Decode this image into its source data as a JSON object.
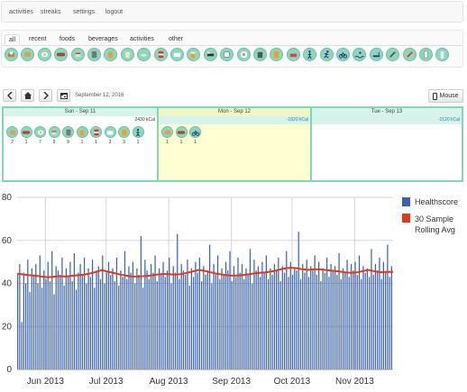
{
  "nav": {
    "items": [
      "activities",
      "streaks",
      "settings",
      "logout"
    ]
  },
  "tabs": {
    "items": [
      "all",
      "recent",
      "foods",
      "beverages",
      "activities",
      "other"
    ],
    "active": "all"
  },
  "icons": [
    "breakfast-icon",
    "toast-icon",
    "egg-icon",
    "hotdog-icon",
    "cake-icon",
    "mixer-icon",
    "jar-icon",
    "drink-icon",
    "bowl-icon",
    "cola-icon",
    "soup-icon",
    "beer-icon",
    "bed-icon",
    "cup-icon",
    "plate-icon",
    "trash-icon",
    "medicine-icon",
    "sofa-icon",
    "walk-icon",
    "run-icon",
    "bike-icon",
    "swim-icon",
    "treadmill-icon",
    "syringe-icon",
    "pencil-icon",
    "blender-icon",
    "bottle-icon"
  ],
  "toolbar": {
    "date": "September 12, 2016",
    "mouse_label": "Mouse"
  },
  "calendar": {
    "days": [
      {
        "header": "Sun - Sep 11",
        "kcal": "2430 kCal",
        "entries": [
          {
            "icon": "toast-icon",
            "count": "2"
          },
          {
            "icon": "hotdog-icon",
            "count": "1"
          },
          {
            "icon": "egg-icon",
            "count": "7"
          },
          {
            "icon": "cake-icon",
            "count": "9"
          },
          {
            "icon": "mixer-icon",
            "count": "9"
          },
          {
            "icon": "jar-icon",
            "count": "1"
          },
          {
            "icon": "cola-icon",
            "count": "1"
          },
          {
            "icon": "soup-icon",
            "count": "3"
          },
          {
            "icon": "medicine-icon",
            "count": "3"
          },
          {
            "icon": "walk-icon",
            "count": "1"
          }
        ]
      },
      {
        "header": "Mon - Sep 12",
        "kcal": "-1920 kCal",
        "entries": [
          {
            "icon": "toast-icon",
            "count": "1"
          },
          {
            "icon": "hotdog-icon",
            "count": "1"
          },
          {
            "icon": "bike-icon",
            "count": "1"
          }
        ]
      },
      {
        "header": "Tue - Sep 13",
        "kcal": "-2120 kCal",
        "entries": []
      }
    ]
  },
  "colors": {
    "accent": "#7fd7b6",
    "icon_bg": "#8ed7bd",
    "today_bg": "#ffffd2",
    "bar": "#3a62b0",
    "avg": "#dd3a1a"
  },
  "chart_data": {
    "type": "bar",
    "title": "",
    "xlabel": "",
    "ylabel": "",
    "ylim": [
      0,
      80
    ],
    "yticks": [
      0,
      20,
      40,
      60,
      80
    ],
    "x_tick_labels": [
      "Jun 2013",
      "Jul 2013",
      "Aug 2013",
      "Sep 2013",
      "Oct 2013",
      "Nov 2013"
    ],
    "x_range": [
      "2013-05-18",
      "2013-11-20"
    ],
    "grid": true,
    "legend": "right",
    "series": [
      {
        "name": "Healthscore",
        "kind": "bar",
        "x_start": "2013-05-18",
        "step_days": 1,
        "values": [
          44,
          49,
          22,
          45,
          40,
          51,
          36,
          47,
          44,
          49,
          40,
          53,
          38,
          46,
          42,
          50,
          41,
          55,
          35,
          48,
          46,
          44,
          52,
          39,
          47,
          43,
          50,
          41,
          54,
          37,
          45,
          49,
          44,
          52,
          40,
          47,
          43,
          51,
          38,
          46,
          48,
          42,
          53,
          40,
          45,
          50,
          44,
          47,
          41,
          52,
          39,
          46,
          43,
          55,
          42,
          48,
          45,
          50,
          40,
          47,
          44,
          62,
          38,
          51,
          46,
          42,
          49,
          45,
          53,
          41,
          47,
          44,
          50,
          43,
          46,
          52,
          40,
          48,
          45,
          63,
          42,
          49,
          46,
          44,
          51,
          39,
          47,
          43,
          50,
          45,
          52,
          41,
          48,
          44,
          46,
          58,
          40,
          49,
          45,
          53,
          42,
          47,
          44,
          50,
          46,
          55,
          41,
          48,
          43,
          52,
          45,
          49,
          42,
          47,
          44,
          56,
          40,
          51,
          46,
          48,
          43,
          50,
          45,
          53,
          42,
          47,
          44,
          49,
          46,
          52,
          41,
          48,
          45,
          55,
          43,
          50,
          44,
          47,
          46,
          64,
          42,
          49,
          45,
          51,
          43,
          48,
          46,
          53,
          44,
          50,
          41,
          47,
          45,
          52,
          43,
          49,
          46,
          48,
          44,
          54,
          42,
          47,
          45,
          51,
          43,
          49,
          46,
          50,
          44,
          53,
          42,
          48,
          45,
          47,
          43,
          56,
          44,
          49,
          46,
          52,
          42,
          50,
          45,
          58,
          43,
          48,
          44,
          51,
          46,
          55,
          42,
          47,
          45,
          52,
          44,
          49
        ]
      },
      {
        "name": "30 Sample Rolling Avg",
        "kind": "line",
        "values": [
          44.5,
          44.2,
          43.8,
          43.6,
          43.2,
          42.9,
          43.1,
          43.4,
          43.2,
          43.5,
          43.8,
          44.1,
          44.6,
          45.3,
          46.2,
          45.4,
          44.8,
          44.1,
          43.6,
          43.2,
          43.2,
          43.4,
          43.7,
          44.1,
          44.4,
          44.3,
          44.1,
          44.3,
          44.9,
          45.6,
          46.3,
          45.8,
          45.1,
          44.5,
          44.0,
          43.7,
          43.6,
          43.8,
          44.2,
          44.6,
          44.9,
          45.1,
          45.6,
          46.2,
          46.9,
          47.3,
          47.1,
          46.6,
          46.3,
          46.6,
          46.5,
          46.2,
          45.9,
          45.6,
          45.2,
          44.9,
          45.1,
          45.7,
          46.3,
          45.6,
          45.2,
          45.4,
          45.3
        ]
      }
    ]
  }
}
